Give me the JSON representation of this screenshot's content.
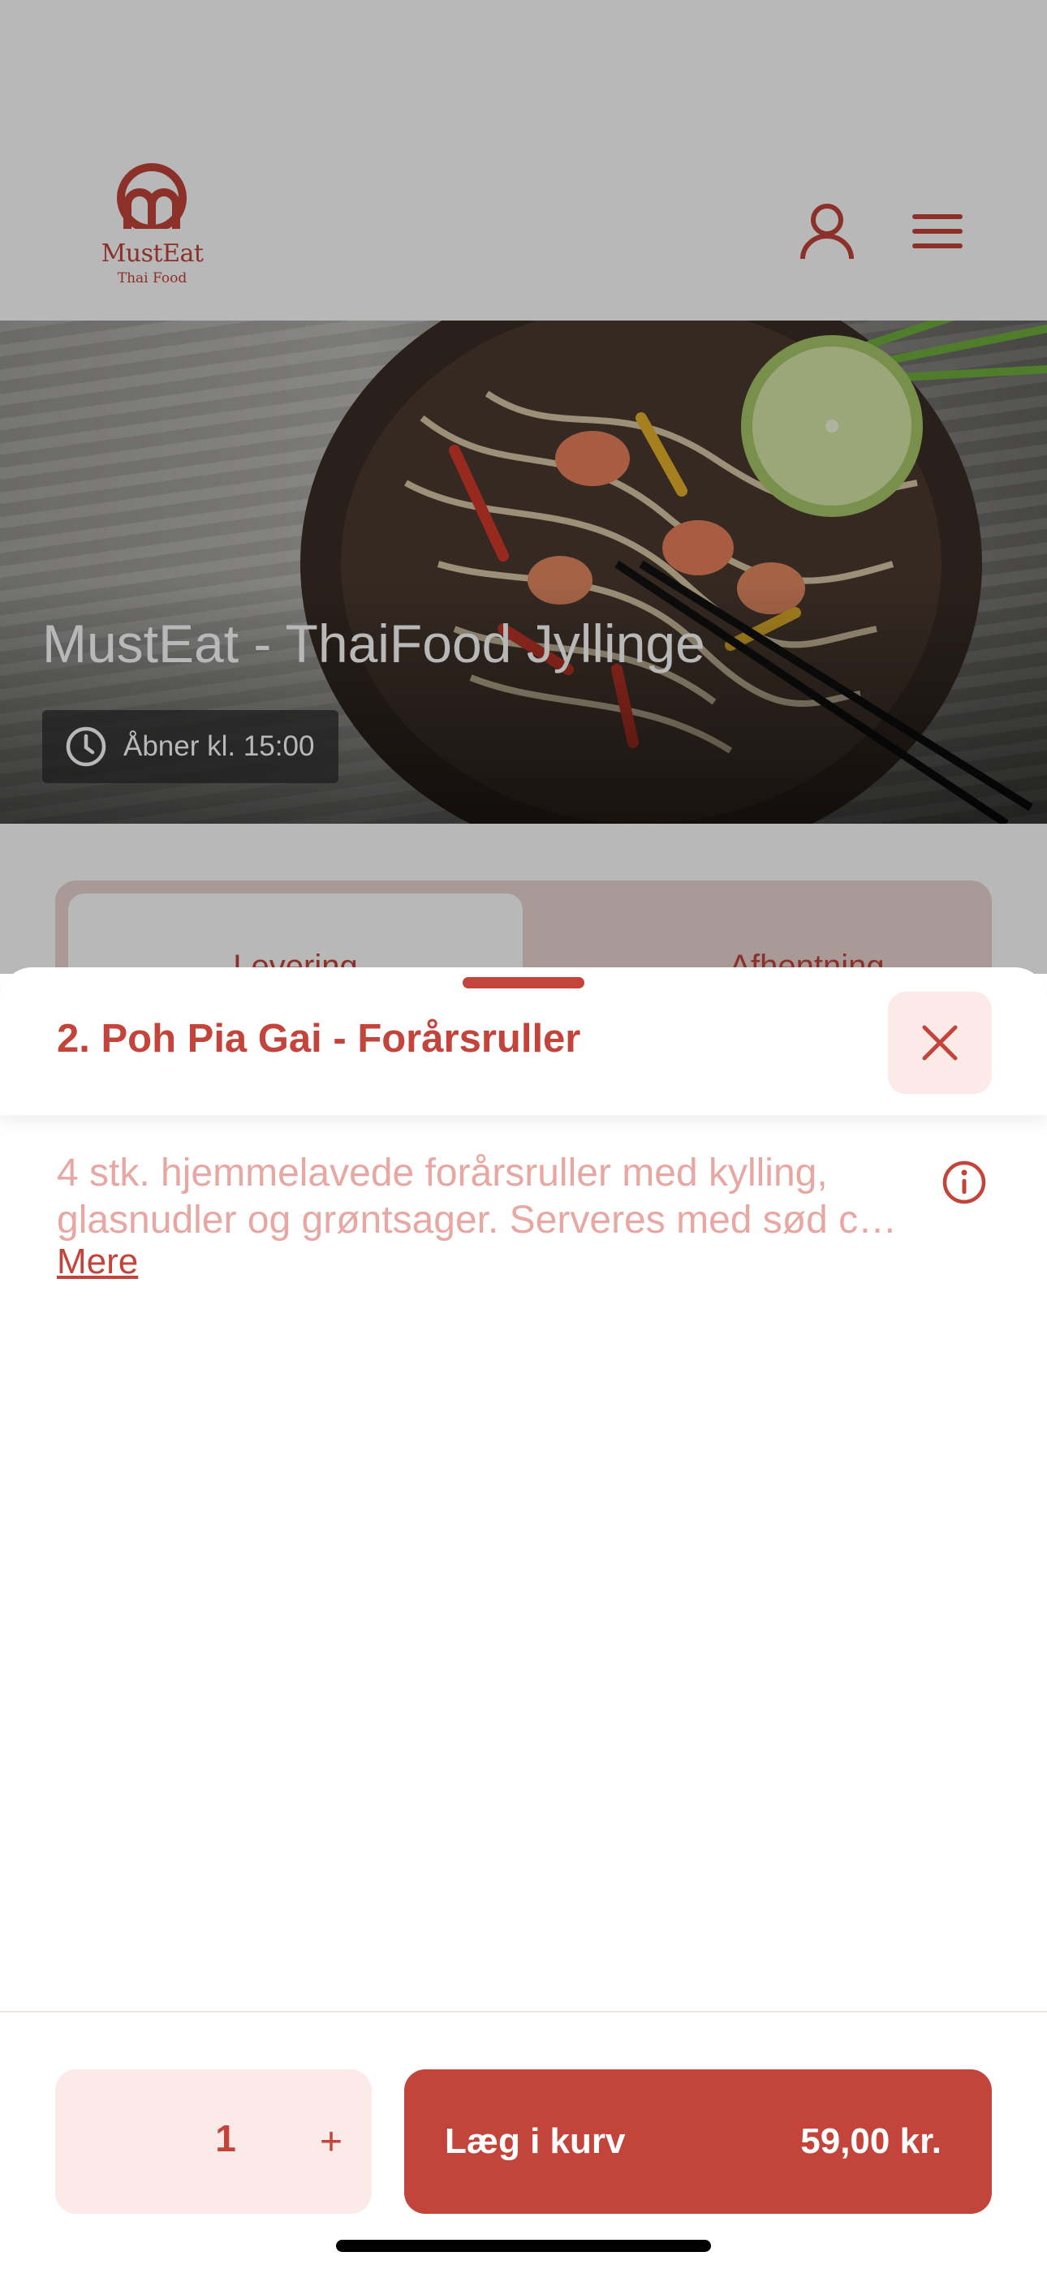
{
  "header": {
    "logo_name": "MustEat",
    "logo_sub": "Thai Food",
    "account_icon": "user-icon",
    "menu_icon": "hamburger-menu-icon"
  },
  "hero": {
    "restaurant_name": "MustEat - ThaiFood Jyllinge",
    "hours_icon": "clock-icon",
    "hours_text": "Åbner kl. 15:00"
  },
  "delivery_toggle": {
    "options": [
      {
        "label": "Levering",
        "selected": true
      },
      {
        "label": "Afhentning",
        "selected": false
      }
    ]
  },
  "product_sheet": {
    "title": "2. Poh Pia Gai - Forårsruller",
    "close_icon": "close-icon",
    "description_line1": "4 stk. hjemmelavede forårsruller med kylling,",
    "description_line2": "glasnudler og grøntsager. Serveres med sød chilisauce",
    "more_label": "Mere",
    "info_icon": "info-icon"
  },
  "footer": {
    "quantity": "1",
    "plus_label": "+",
    "add_to_cart_label": "Læg i kurv",
    "price": "59,00 kr."
  },
  "colors": {
    "brand": "#c2443a",
    "brand_light": "#fbeae8",
    "description_text": "#e7a7a2"
  }
}
